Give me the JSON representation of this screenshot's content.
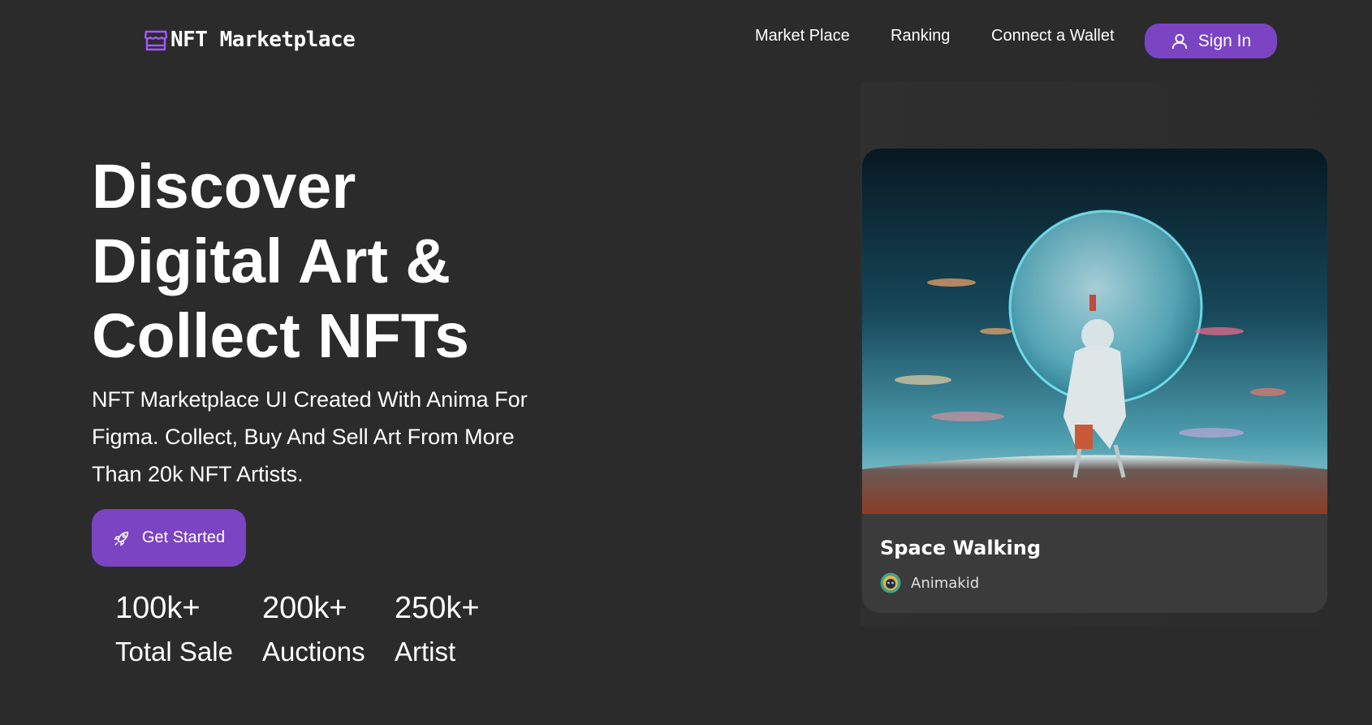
{
  "brand": {
    "name": "NFT Marketplace",
    "icon": "storefront-icon",
    "accent": "#7b44c3"
  },
  "nav": {
    "items": [
      {
        "label": "Market Place"
      },
      {
        "label": "Ranking"
      },
      {
        "label": "Connect a Wallet"
      }
    ],
    "signin": {
      "label": "Sign In",
      "icon": "user-icon"
    }
  },
  "hero": {
    "title_lines": [
      "Discover",
      "Digital Art &",
      "Collect NFTs"
    ],
    "subtitle": "NFT Marketplace UI Created With Anima For Figma. Collect, Buy And Sell Art From More Than 20k NFT Artists.",
    "cta": {
      "label": "Get Started",
      "icon": "rocket-icon"
    },
    "stats": [
      {
        "value": "100k+",
        "label": "Total Sale"
      },
      {
        "value": "200k+",
        "label": "Auctions"
      },
      {
        "value": "250k+",
        "label": "Artist"
      }
    ]
  },
  "featured": {
    "title": "Space Walking",
    "artist": "Animakid",
    "image": "astronaut-planet-artwork"
  },
  "colors": {
    "background": "#2b2b2b",
    "card": "#3b3b3b",
    "accent": "#7b44c3"
  }
}
